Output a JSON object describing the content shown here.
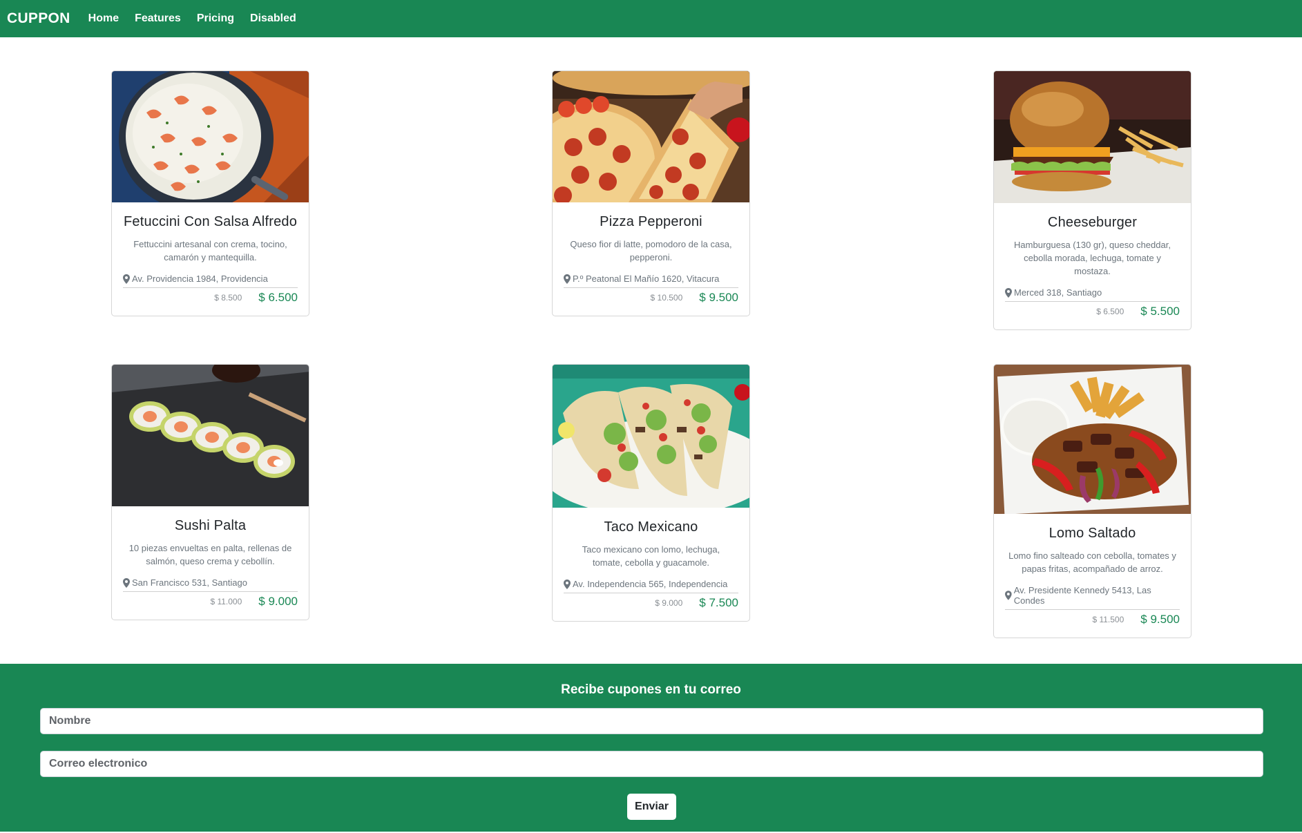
{
  "navbar": {
    "brand": "CUPPON",
    "links": [
      "Home",
      "Features",
      "Pricing",
      "Disabled"
    ]
  },
  "colors": {
    "primary": "#198754",
    "price": "#198754",
    "muted": "#6c757d"
  },
  "cards": [
    {
      "title": "Fetuccini Con Salsa Alfredo",
      "description": "Fettuccini artesanal con crema, tocino, camarón y mantequilla.",
      "location_icon": "map-marker-icon",
      "location": "Av. Providencia 1984, Providencia",
      "old_price": "$ 8.500",
      "price": "$ 6.500",
      "image": "pasta-alfredo-shrimp-image"
    },
    {
      "title": "Pizza Pepperoni",
      "description": "Queso fior di latte, pomodoro de la casa, pepperoni.",
      "location_icon": "map-marker-icon",
      "location": "P.º Peatonal El Mañío 1620, Vitacura",
      "old_price": "$ 10.500",
      "price": "$ 9.500",
      "image": "pepperoni-pizza-image"
    },
    {
      "title": "Cheeseburger",
      "description": "Hamburguesa (130 gr), queso cheddar, cebolla morada, lechuga, tomate y mostaza.",
      "location_icon": "map-marker-icon",
      "location": "Merced 318, Santiago",
      "old_price": "$ 6.500",
      "price": "$ 5.500",
      "image": "cheeseburger-image"
    },
    {
      "title": "Sushi Palta",
      "description": "10 piezas envueltas en palta, rellenas de salmón, queso crema y cebollín.",
      "location_icon": "map-marker-icon",
      "location": "San Francisco 531, Santiago",
      "old_price": "$ 11.000",
      "price": "$ 9.000",
      "image": "avocado-sushi-image"
    },
    {
      "title": "Taco Mexicano",
      "description": "Taco mexicano con lomo, lechuga, tomate, cebolla y guacamole.",
      "location_icon": "map-marker-icon",
      "location": "Av. Independencia 565, Independencia",
      "old_price": "$ 9.000",
      "price": "$ 7.500",
      "image": "tacos-image"
    },
    {
      "title": "Lomo Saltado",
      "description": "Lomo fino salteado con cebolla, tomates y papas fritas, acompañado de arroz.",
      "location_icon": "map-marker-icon",
      "location": "Av. Presidente Kennedy 5413, Las Condes",
      "old_price": "$ 11.500",
      "price": "$ 9.500",
      "image": "lomo-saltado-image"
    }
  ],
  "subscribe": {
    "title": "Recibe cupones en tu correo",
    "name_placeholder": "Nombre",
    "email_placeholder": "Correo electronico",
    "submit_label": "Enviar"
  }
}
